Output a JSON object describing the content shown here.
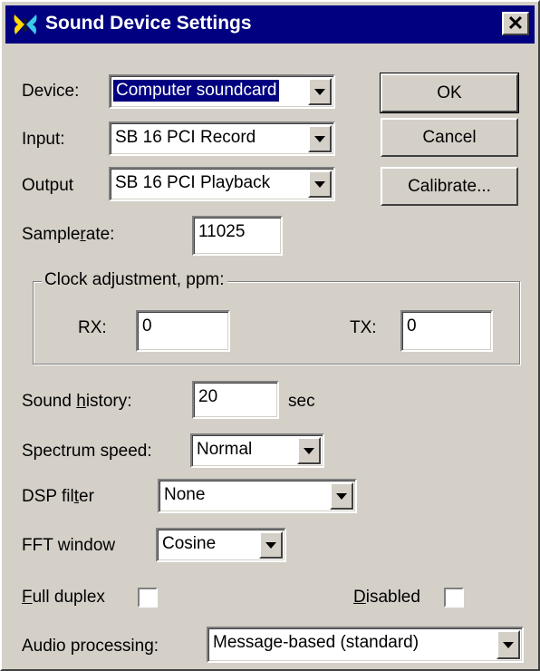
{
  "window": {
    "title": "Sound Device Settings",
    "close_label": "✕",
    "title_bar_color": "#000080",
    "icon": "butterfly-app-icon"
  },
  "device": {
    "label": "Device:",
    "value": "Computer soundcard"
  },
  "input": {
    "label": "Input:",
    "value": "SB 16 PCI Record"
  },
  "output": {
    "label": "Output",
    "value": "SB 16 PCI Playback"
  },
  "buttons": {
    "ok": "OK",
    "cancel": "Cancel",
    "calibrate": "Calibrate..."
  },
  "samplerate": {
    "label_pre": "Sample",
    "label_accel": "r",
    "label_post": "ate:",
    "value": "11025"
  },
  "clock": {
    "legend": "Clock adjustment, ppm:",
    "rx_label": "RX:",
    "rx_value": "0",
    "tx_label": "TX:",
    "tx_value": "0"
  },
  "sound_history": {
    "label_pre": "Sound ",
    "label_accel": "h",
    "label_post": "istory:",
    "value": "20",
    "unit": "sec"
  },
  "spectrum_speed": {
    "label": "Spectrum speed:",
    "value": "Normal"
  },
  "dsp_filter": {
    "label_pre": "DSP fil",
    "label_accel": "t",
    "label_post": "er",
    "value": "None"
  },
  "fft_window": {
    "label": "FFT window",
    "value": "Cosine"
  },
  "full_duplex": {
    "label_accel": "F",
    "label_post": "ull duplex",
    "checked": false
  },
  "disabled": {
    "label_accel": "D",
    "label_post": "isabled",
    "checked": false
  },
  "audio_processing": {
    "label": "Audio processing:",
    "value": "Message-based (standard)"
  }
}
